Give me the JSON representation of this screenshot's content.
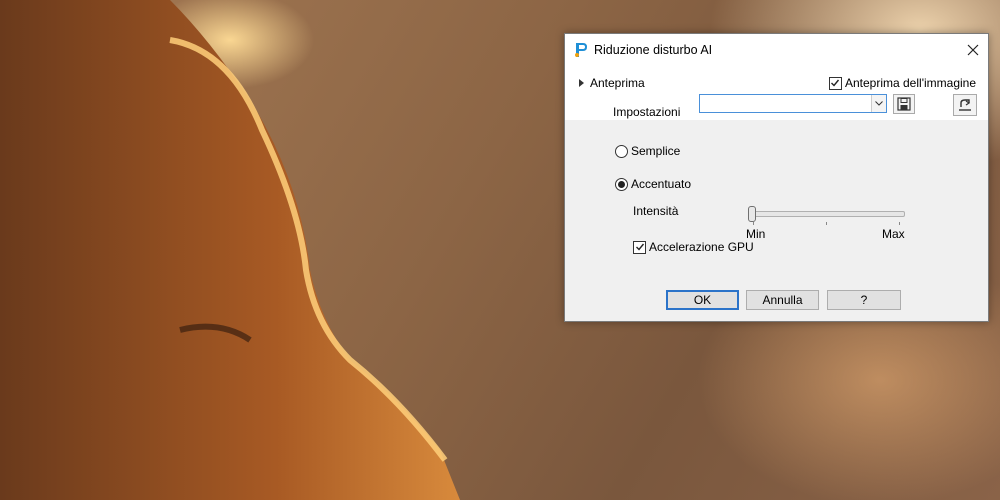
{
  "dialog": {
    "title": "Riduzione disturbo AI",
    "preview_toggle_label": "Anteprima",
    "preview_image_label": "Anteprima dell'immagine",
    "preview_image_checked": true,
    "settings_label": "Impostazioni",
    "settings_value": "",
    "modes": [
      {
        "label": "Semplice",
        "selected": false
      },
      {
        "label": "Accentuato",
        "selected": true
      }
    ],
    "intensity": {
      "label": "Intensità",
      "min_label": "Min",
      "max_label": "Max",
      "value_fraction": 0.0
    },
    "gpu_label": "Accelerazione GPU",
    "gpu_checked": true,
    "buttons": {
      "ok": "OK",
      "cancel": "Annulla",
      "help": "?"
    }
  },
  "colors": {
    "accent": "#2b73c9",
    "dialog_bg": "#f0f0f0"
  },
  "icons": [
    "app-logo-icon",
    "close-icon",
    "expand-triangle-icon",
    "checkmark-icon",
    "dropdown-arrow-icon",
    "save-preset-icon",
    "reset-preset-icon"
  ]
}
